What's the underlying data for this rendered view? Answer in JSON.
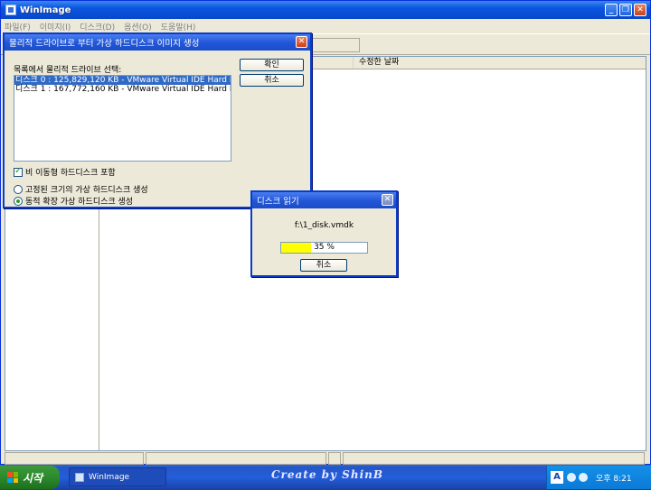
{
  "main_window": {
    "title": "WinImage",
    "menu": [
      "파일(F)",
      "이미지(I)",
      "디스크(D)",
      "옵션(O)",
      "도움말(H)"
    ],
    "columns": [
      "수정한 날짜"
    ]
  },
  "create_dialog": {
    "title": "물리적 드라이브로 부터 가상 하드디스크 이미지 생성",
    "list_label": "목록에서 물리적 드라이브 선택:",
    "drives": [
      "디스크 0 : 125,829,120 KB - VMware Virtual IDE Hard Drive 00",
      "디스크 1 : 167,772,160 KB - VMware Virtual IDE Hard Drive 00"
    ],
    "ok_label": "확인",
    "cancel_label": "취소",
    "removable_checkbox": "비 이동형 하드디스크 포함",
    "radio_fixed": "고정된 크기의 가상 하드디스크 생성",
    "radio_dynamic": "동적 확장 가상 하드디스크 생성"
  },
  "read_dialog": {
    "title": "디스크 읽기",
    "file": "f:\\1_disk.vmdk",
    "progress_text": "35 %",
    "progress": 0.35,
    "cancel_label": "취소"
  },
  "taskbar": {
    "start_label": "시작",
    "task_item": "WinImage",
    "watermark": "Create by ShinB",
    "ime": "A",
    "clock": "오후 8:21"
  },
  "colors": {
    "title_blue": "#0a55e0",
    "progress_fill": "#ffff00",
    "selection": "#316ac5",
    "start_green": "#2c8a2c"
  }
}
